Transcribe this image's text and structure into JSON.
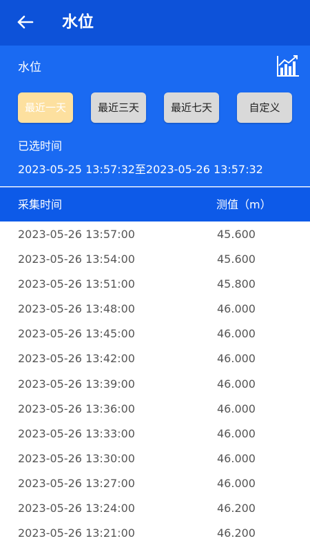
{
  "appbar": {
    "title": "水位",
    "back_icon": "arrow-left-icon"
  },
  "panel": {
    "label": "水位",
    "chart_icon": "bar-chart-trend-icon",
    "range_buttons": [
      {
        "label": "最近一天",
        "active": true
      },
      {
        "label": "最近三天",
        "active": false
      },
      {
        "label": "最近七天",
        "active": false
      },
      {
        "label": "自定义",
        "active": false
      }
    ],
    "selected_label": "已选时间",
    "selected_range": "2023-05-25 13:57:32至2023-05-26 13:57:32"
  },
  "table": {
    "headers": {
      "time": "采集时间",
      "value": "测值（m）"
    },
    "rows": [
      {
        "time": "2023-05-26 13:57:00",
        "value": "45.600"
      },
      {
        "time": "2023-05-26 13:54:00",
        "value": "45.600"
      },
      {
        "time": "2023-05-26 13:51:00",
        "value": "45.800"
      },
      {
        "time": "2023-05-26 13:48:00",
        "value": "46.000"
      },
      {
        "time": "2023-05-26 13:45:00",
        "value": "46.000"
      },
      {
        "time": "2023-05-26 13:42:00",
        "value": "46.000"
      },
      {
        "time": "2023-05-26 13:39:00",
        "value": "46.000"
      },
      {
        "time": "2023-05-26 13:36:00",
        "value": "46.000"
      },
      {
        "time": "2023-05-26 13:33:00",
        "value": "46.000"
      },
      {
        "time": "2023-05-26 13:30:00",
        "value": "46.000"
      },
      {
        "time": "2023-05-26 13:27:00",
        "value": "46.000"
      },
      {
        "time": "2023-05-26 13:24:00",
        "value": "46.200"
      },
      {
        "time": "2023-05-26 13:21:00",
        "value": "46.200"
      }
    ]
  },
  "colors": {
    "appbar": "#0d52d9",
    "panel": "#1a6af2",
    "table_header": "#0d5ae8",
    "active_button": "#fde09f",
    "inactive_button": "#d9d9d9"
  }
}
